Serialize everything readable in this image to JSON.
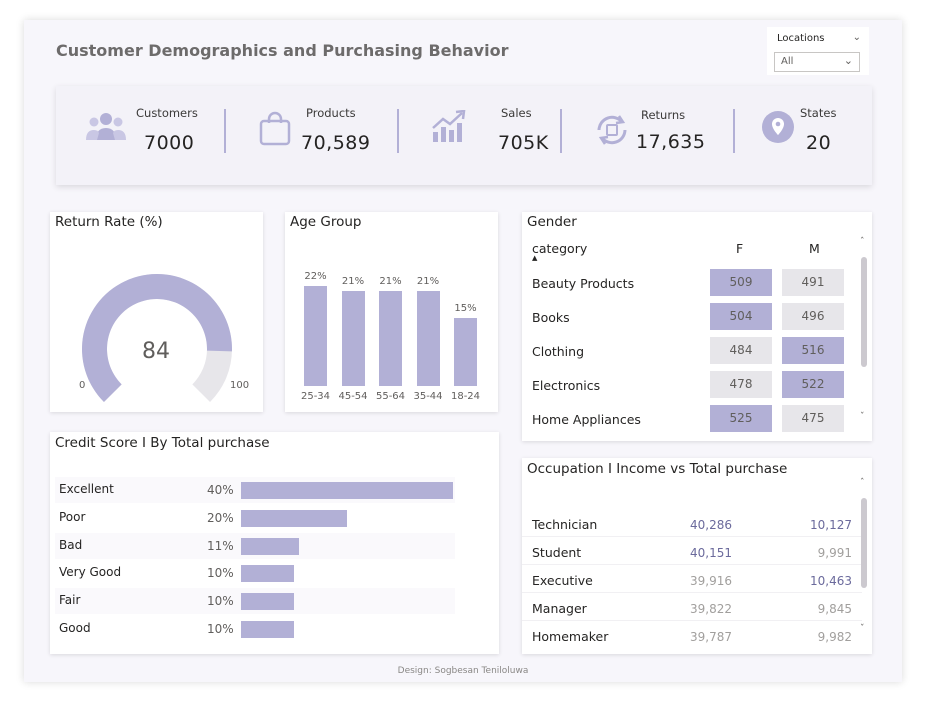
{
  "title": "Customer Demographics and Purchasing Behavior",
  "slicer": {
    "label": "Locations",
    "value": "All"
  },
  "kpis": [
    {
      "label": "Customers",
      "value": "7000",
      "icon": "people-icon"
    },
    {
      "label": "Products",
      "value": "70,589",
      "icon": "shopping-bag-icon"
    },
    {
      "label": "Sales",
      "value": "705K",
      "icon": "growth-chart-icon"
    },
    {
      "label": "Returns",
      "value": "17,635",
      "icon": "return-cycle-icon"
    },
    {
      "label": "States",
      "value": "20",
      "icon": "location-pin-icon"
    }
  ],
  "colors": {
    "accent": "#b2b0d6",
    "accent_text": "#6b6a9c",
    "grey_cell": "#e7e6ea"
  },
  "return_rate": {
    "title": "Return Rate (%)",
    "value": "84",
    "min": "0",
    "max": "100",
    "fraction": 0.84
  },
  "age_group": {
    "title": "Age Group",
    "chart_data": {
      "type": "bar",
      "categories": [
        "25-34",
        "45-54",
        "55-64",
        "35-44",
        "18-24"
      ],
      "values": [
        22,
        21,
        21,
        21,
        15
      ],
      "labels": [
        "22%",
        "21%",
        "21%",
        "21%",
        "15%"
      ]
    }
  },
  "gender": {
    "title": "Gender",
    "col_category": "category",
    "col_f": "F",
    "col_m": "M",
    "rows": [
      {
        "category": "Beauty Products",
        "f": "509",
        "m": "491",
        "hi": "f"
      },
      {
        "category": "Books",
        "f": "504",
        "m": "496",
        "hi": "f"
      },
      {
        "category": "Clothing",
        "f": "484",
        "m": "516",
        "hi": "m"
      },
      {
        "category": "Electronics",
        "f": "478",
        "m": "522",
        "hi": "m"
      },
      {
        "category": "Home Appliances",
        "f": "525",
        "m": "475",
        "hi": "f"
      }
    ]
  },
  "credit": {
    "title": "Credit Score I By Total purchase",
    "chart_data": {
      "type": "bar",
      "categories": [
        "Excellent",
        "Poor",
        "Bad",
        "Very Good",
        "Fair",
        "Good"
      ],
      "values": [
        40,
        20,
        11,
        10,
        10,
        10
      ],
      "labels": [
        "40%",
        "20%",
        "11%",
        "10%",
        "10%",
        "10%"
      ]
    }
  },
  "occupation": {
    "title": "Occupation I Income vs Total purchase",
    "rows": [
      {
        "name": "Technician",
        "v1": "40,286",
        "v2": "10,127",
        "h1": true,
        "h2": true
      },
      {
        "name": "Student",
        "v1": "40,151",
        "v2": "9,991",
        "h1": true,
        "h2": false
      },
      {
        "name": "Executive",
        "v1": "39,916",
        "v2": "10,463",
        "h1": false,
        "h2": true
      },
      {
        "name": "Manager",
        "v1": "39,822",
        "v2": "9,845",
        "h1": false,
        "h2": false
      },
      {
        "name": "Homemaker",
        "v1": "39,787",
        "v2": "9,982",
        "h1": false,
        "h2": false
      }
    ]
  },
  "footer": "Design: Sogbesan Teniloluwa"
}
